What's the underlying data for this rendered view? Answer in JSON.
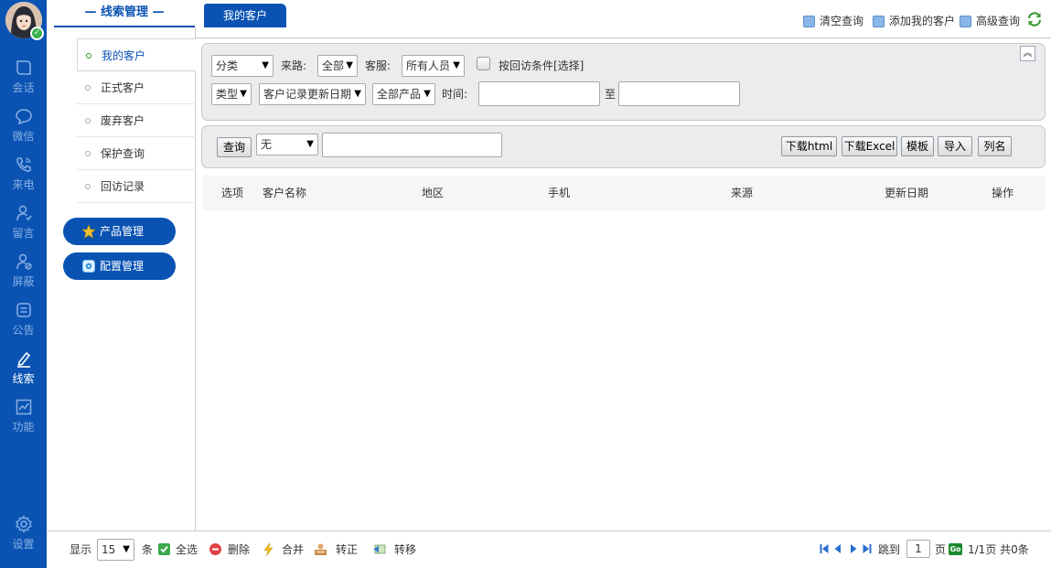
{
  "rail": {
    "items": [
      {
        "label": "会话",
        "icon": "chat-bubble-icon"
      },
      {
        "label": "微信",
        "icon": "wechat-icon"
      },
      {
        "label": "来电",
        "icon": "phone-icon"
      },
      {
        "label": "留言",
        "icon": "message-user-icon"
      },
      {
        "label": "屏蔽",
        "icon": "block-user-icon"
      },
      {
        "label": "公告",
        "icon": "notice-icon"
      },
      {
        "label": "线索",
        "icon": "pen-icon"
      },
      {
        "label": "功能",
        "icon": "chart-icon"
      }
    ],
    "settings_label": "设置",
    "colors": {
      "rail": "#0a53b3",
      "inactive": "#8ab0e4",
      "active": "#ffffff"
    }
  },
  "nav": {
    "title": "— 线索管理 —",
    "items": [
      "我的客户",
      "正式客户",
      "废弃客户",
      "保护查询",
      "回访记录"
    ],
    "pills": [
      "产品管理",
      "配置管理"
    ]
  },
  "tabs": {
    "active": "我的客户"
  },
  "toolbar": {
    "clear_query": "清空查询",
    "add_my_customer": "添加我的客户",
    "advanced_query": "高级查询"
  },
  "filters": {
    "category": "分类",
    "source_label": "来路:",
    "source_value": "全部",
    "service_label": "客服:",
    "service_value": "所有人员",
    "visit_condition": "按回访条件[选择]",
    "type": "类型",
    "date_field": "客户记录更新日期",
    "product": "全部产品",
    "time_label": "时间:",
    "to_label": "至"
  },
  "search": {
    "query_button": "查询",
    "field_value": "无",
    "download_html": "下载html",
    "download_excel": "下载Excel",
    "template": "模板",
    "import": "导入",
    "columns": "列名"
  },
  "table": {
    "headers": [
      "选项",
      "客户名称",
      "地区",
      "手机",
      "来源",
      "更新日期",
      "操作"
    ],
    "rows": []
  },
  "footer": {
    "show_label": "显示",
    "page_size": "15",
    "unit": "条",
    "select_all": "全选",
    "delete": "删除",
    "merge": "合并",
    "convert": "转正",
    "transfer": "转移",
    "jump_label": "跳到",
    "page_input": "1",
    "page_label": "页",
    "go": "Go",
    "page_info": "1/1页 共0条"
  }
}
